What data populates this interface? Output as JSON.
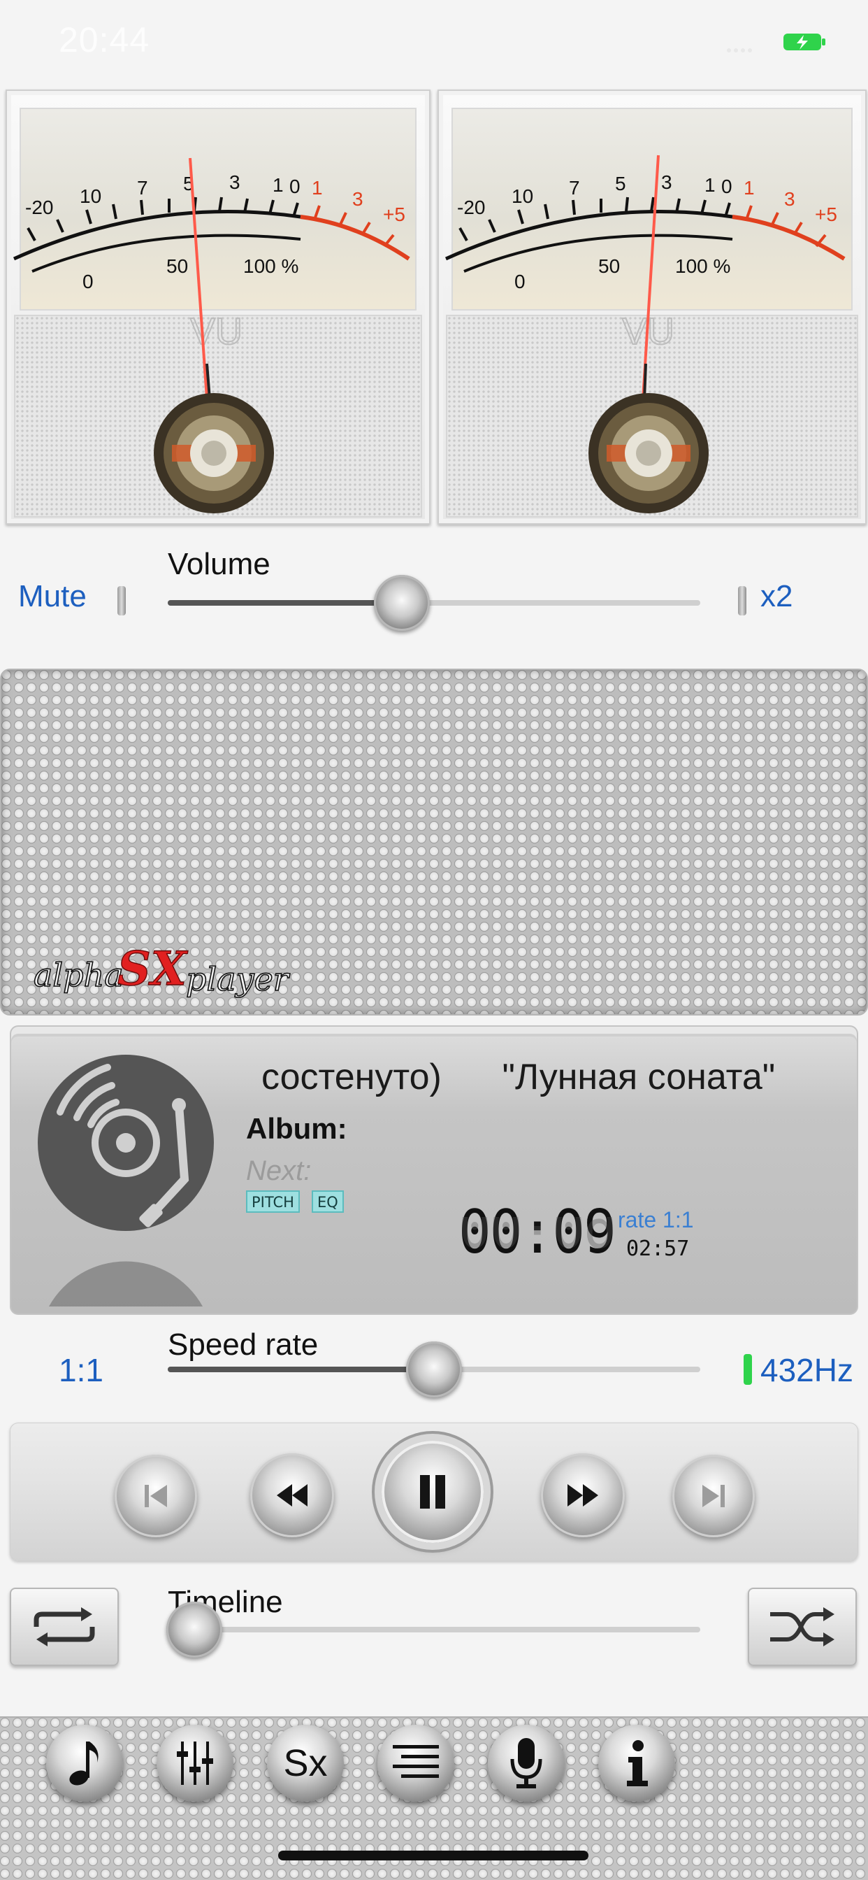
{
  "status_bar": {
    "time": "20:44",
    "battery_icon": "battery-charging-icon",
    "battery_color": "#2fd34b"
  },
  "vu_meters": {
    "scale_top": [
      "-20",
      "10",
      "7",
      "5",
      "3",
      "1",
      "0",
      "1",
      "3",
      "+5"
    ],
    "scale_bottom": [
      "0",
      "50",
      "100 %"
    ],
    "unit": "VU",
    "needle_color": "#ff5a4a",
    "red_zone_color": "#e0401e"
  },
  "volume": {
    "label": "Volume",
    "mute_label": "Mute",
    "max_label": "x2",
    "level": 0.44
  },
  "logo": {
    "text_left": "alpha",
    "text_mid": "SX",
    "text_right": "player",
    "accent_color": "#e12020"
  },
  "now_playing": {
    "title": "состенуто)      \"Лунная соната\"",
    "album_label": "Album:",
    "next_label": "Next:",
    "badges": [
      "PITCH",
      "EQ"
    ],
    "elapsed": "00:09",
    "rate_label": "rate 1:1",
    "duration": "02:57",
    "art_icon": "turntable-icon"
  },
  "speed_rate": {
    "label": "Speed rate",
    "ratio": "1:1",
    "hz": "432Hz",
    "indicator_color": "#2fd34b",
    "level": 0.5
  },
  "transport": {
    "buttons": [
      "skip-previous",
      "rewind",
      "pause",
      "fast-forward",
      "skip-next"
    ]
  },
  "timeline": {
    "label": "Timeline",
    "progress": 0.05
  },
  "tabbar": {
    "items": [
      "music-note-icon",
      "equalizer-icon",
      "Sx",
      "playlist-icon",
      "microphone-icon",
      "info-icon"
    ],
    "sx_label": "Sx"
  },
  "colors": {
    "link_blue": "#1d5fbf",
    "rate_blue": "#3a7fd2"
  }
}
